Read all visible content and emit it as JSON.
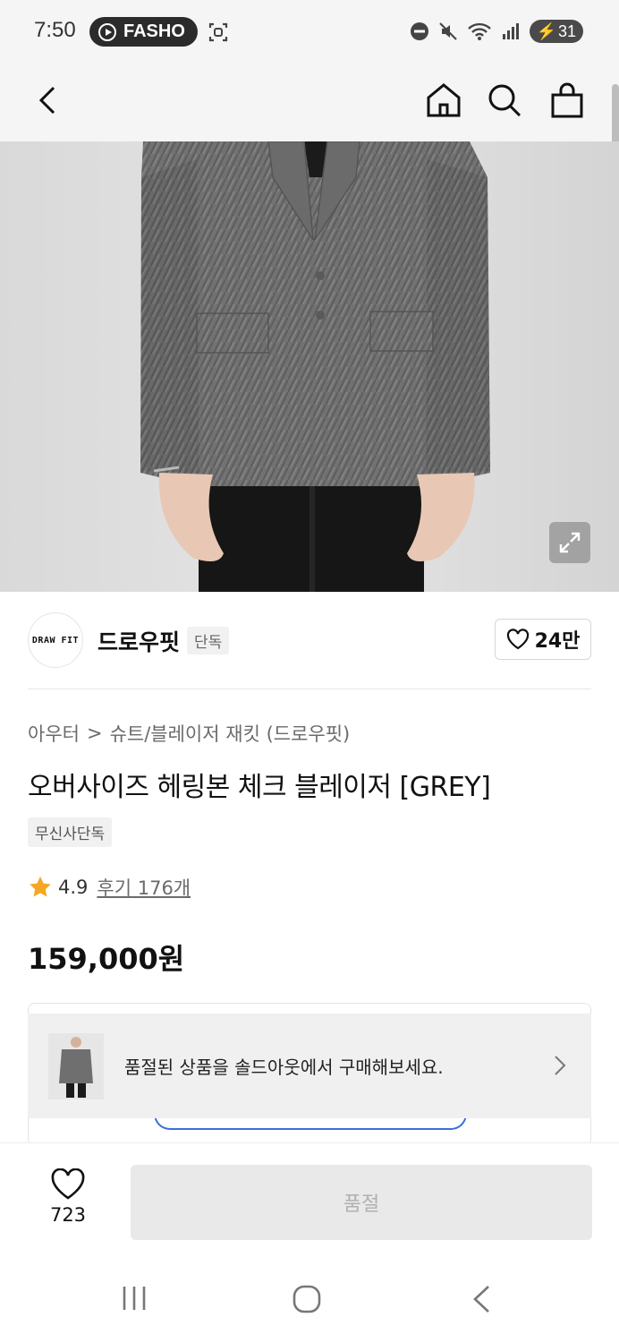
{
  "status_bar": {
    "time": "7:50",
    "app_pill": "FASHO",
    "battery": "31",
    "icons": [
      "screen-record-icon",
      "do-not-disturb-icon",
      "mute-icon",
      "wifi-icon",
      "signal-icon",
      "battery-charging-icon"
    ]
  },
  "header": {
    "icons": [
      "back-icon",
      "home-icon",
      "search-icon",
      "cart-icon"
    ]
  },
  "brand": {
    "logo_text": "DRAW FIT",
    "name": "드로우핏",
    "badge": "단독",
    "like_count": "24만"
  },
  "breadcrumb": {
    "category": "아우터",
    "separator": ">",
    "subcategory": "슈트/블레이저 재킷 (드로우핏)"
  },
  "product": {
    "title": "오버사이즈 헤링본 체크 블레이저 [GREY]",
    "tag": "무신사단독",
    "rating": "4.9",
    "reviews": "후기 176개",
    "price": "159,000원"
  },
  "banner": {
    "text": "품절된 상품을 솔드아웃에서 구매해보세요."
  },
  "bottom_bar": {
    "like_count": "723",
    "buy_label": "품절"
  },
  "colors": {
    "star": "#f5a623",
    "coupon_border": "#3b6fd8",
    "disabled_button": "#e9e9e9"
  }
}
